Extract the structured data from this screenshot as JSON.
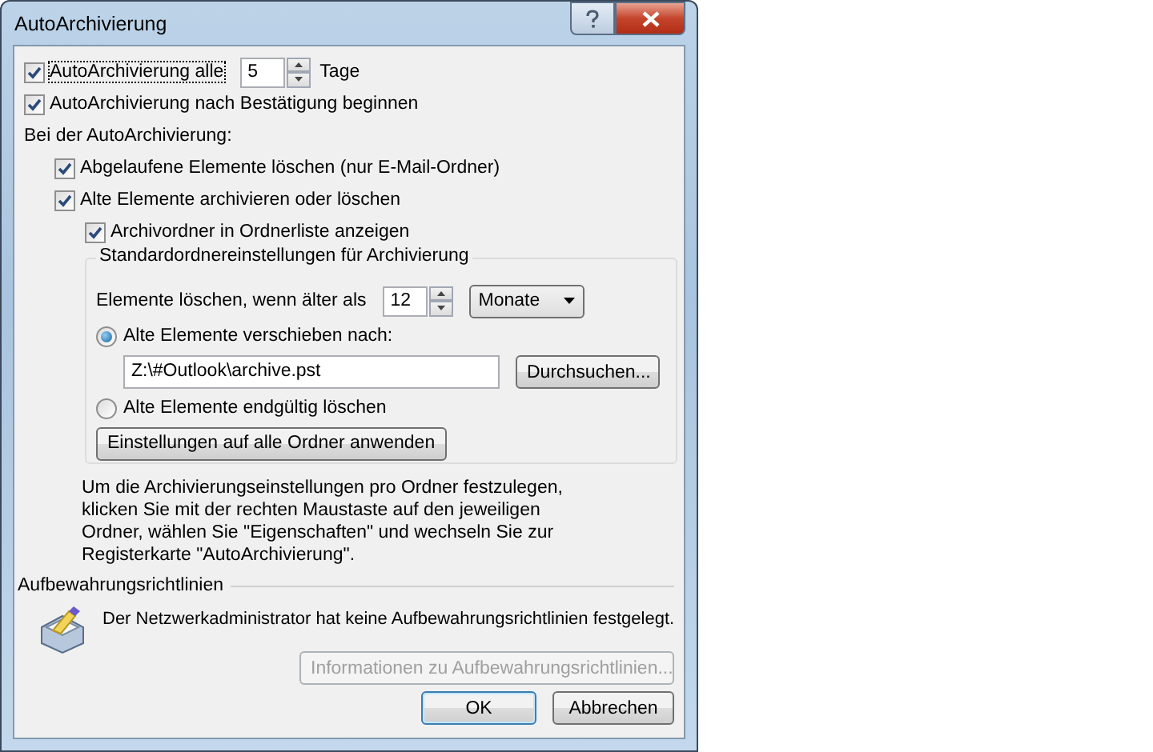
{
  "window": {
    "title": "AutoArchivierung"
  },
  "autoarchive": {
    "label": "AutoArchivierung alle",
    "checked": true,
    "value": "5",
    "unit": "Tage"
  },
  "prompt": {
    "label": "AutoArchivierung nach Bestätigung beginnen",
    "checked": true
  },
  "during_label": "Bei der AutoArchivierung:",
  "options": [
    {
      "label": "Abgelaufene Elemente löschen (nur E-Mail-Ordner)",
      "checked": true
    },
    {
      "label": "Alte Elemente archivieren oder löschen",
      "checked": true
    }
  ],
  "show_folder": {
    "label": "Archivordner in Ordnerliste anzeigen",
    "checked": true
  },
  "defaults": {
    "title": "Standardordnereinstellungen für Archivierung",
    "age_label": "Elemente löschen, wenn älter als",
    "age_value": "12",
    "age_unit": "Monate",
    "actions": [
      {
        "label": "Alte Elemente verschieben nach:",
        "selected": true
      },
      {
        "label": "Alte Elemente endgültig löschen",
        "selected": false
      }
    ],
    "path": "Z:\\#Outlook\\archive.pst",
    "browse_button": "Durchsuchen...",
    "apply_button": "Einstellungen auf alle Ordner anwenden"
  },
  "hint": "Um die Archivierungseinstellungen pro Ordner festzulegen, klicken Sie mit der rechten Maustaste auf den jeweiligen Ordner, wählen Sie \"Eigenschaften\" und wechseln Sie zur Registerkarte \"AutoArchivierung\".",
  "retention": {
    "title": "Aufbewahrungsrichtlinien",
    "message": "Der Netzwerkadministrator hat keine Aufbewahrungsrichtlinien festgelegt.",
    "info_button": {
      "label": "Informationen zu Aufbewahrungsrichtlinien...",
      "disabled": true
    }
  },
  "buttons": [
    {
      "label": "OK",
      "default": true
    },
    {
      "label": "Abbrechen",
      "default": false
    }
  ]
}
